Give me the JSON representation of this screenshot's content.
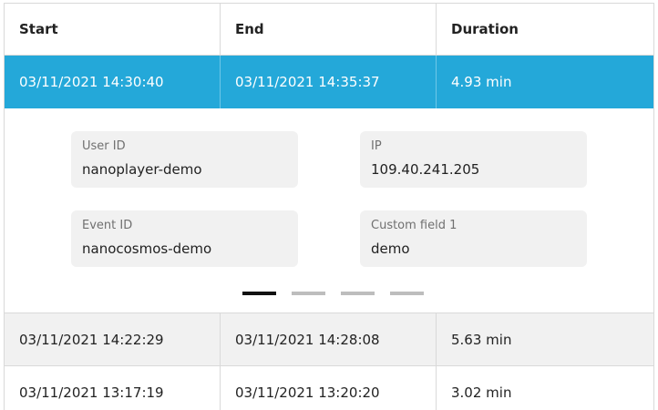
{
  "table": {
    "headers": [
      "Start",
      "End",
      "Duration"
    ],
    "selected": {
      "start": "03/11/2021 14:30:40",
      "end": "03/11/2021 14:35:37",
      "duration": "4.93 min"
    },
    "details": {
      "user_id_label": "User ID",
      "user_id_value": "nanoplayer-demo",
      "ip_label": "IP",
      "ip_value": "109.40.241.205",
      "event_id_label": "Event ID",
      "event_id_value": "nanocosmos-demo",
      "custom_label": "Custom field 1",
      "custom_value": "demo",
      "pager": {
        "page_count": 4,
        "active_page": 1
      }
    },
    "rows": [
      {
        "start": "03/11/2021 14:22:29",
        "end": "03/11/2021 14:28:08",
        "duration": "5.63 min"
      },
      {
        "start": "03/11/2021 13:17:19",
        "end": "03/11/2021 13:20:20",
        "duration": "3.02 min"
      }
    ]
  },
  "colors": {
    "selected_row": "#24a8d9",
    "card_background": "#f1f1f1",
    "alt_row": "#f1f1f1",
    "active_pager": "#111111",
    "inactive_pager": "#bdbdbd"
  }
}
